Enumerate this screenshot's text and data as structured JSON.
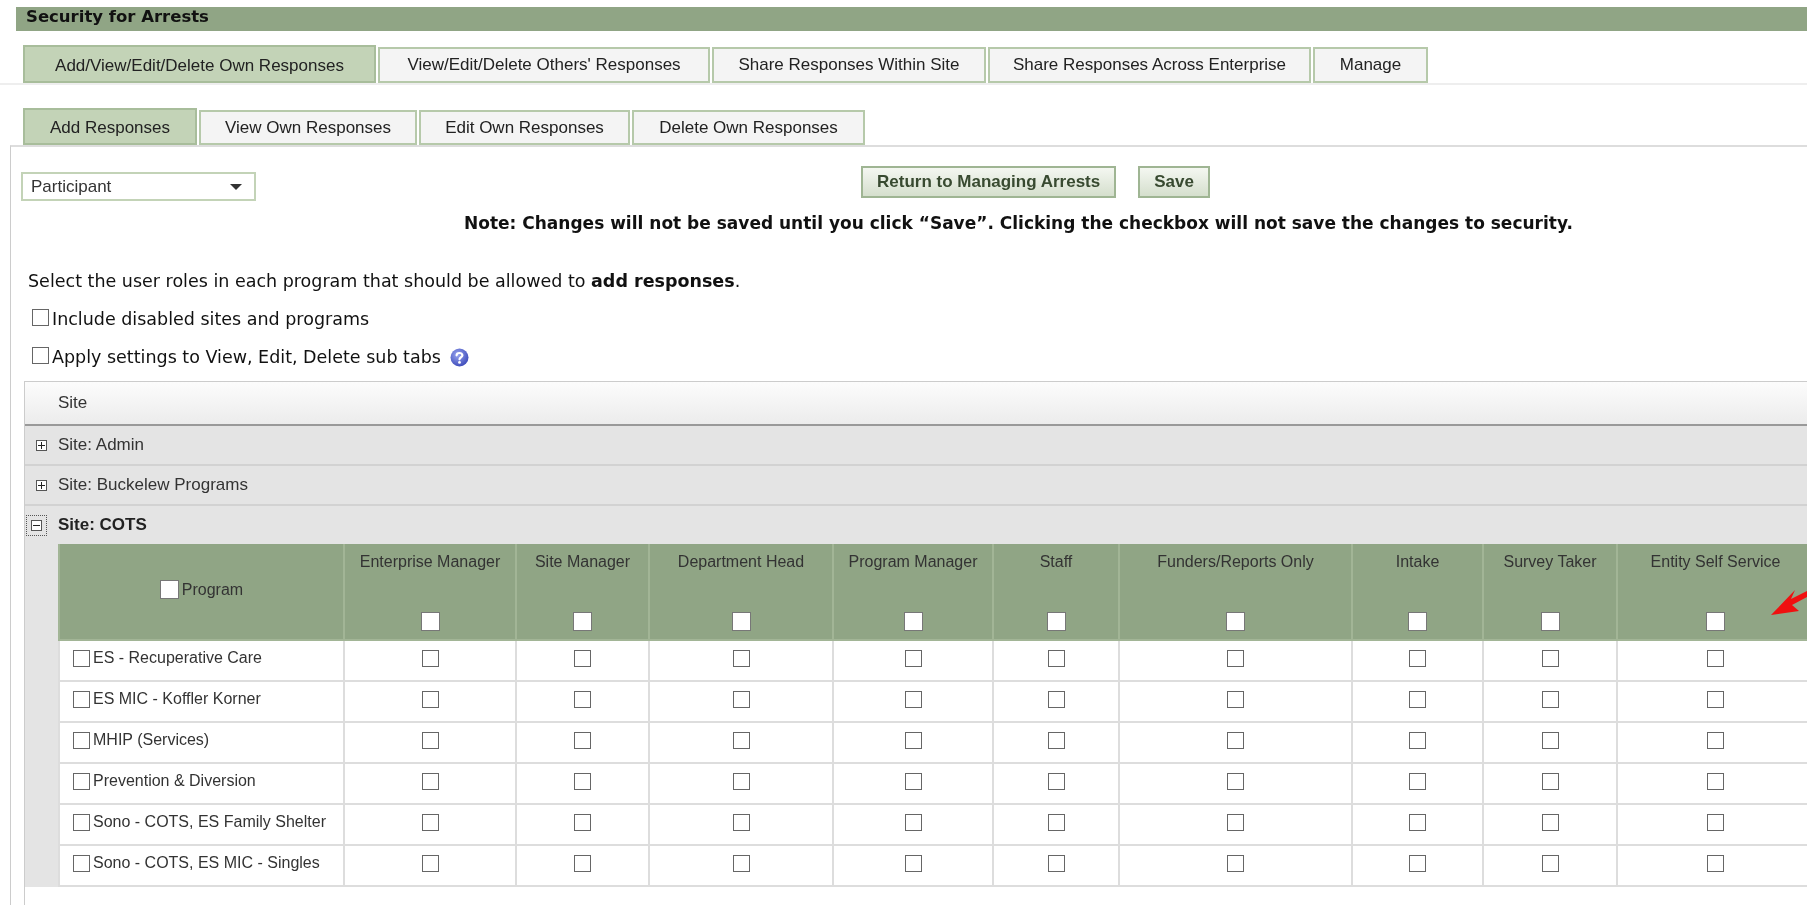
{
  "page_title": "Security for Arrests",
  "main_tabs": [
    {
      "label": "Add/View/Edit/Delete Own Responses",
      "selected": true
    },
    {
      "label": "View/Edit/Delete Others' Responses",
      "selected": false
    },
    {
      "label": "Share Responses Within Site",
      "selected": false
    },
    {
      "label": "Share Responses Across Enterprise",
      "selected": false
    },
    {
      "label": "Manage",
      "selected": false
    }
  ],
  "sub_tabs": [
    {
      "label": "Add Responses",
      "selected": true
    },
    {
      "label": "View Own Responses",
      "selected": false
    },
    {
      "label": "Edit Own Responses",
      "selected": false
    },
    {
      "label": "Delete Own Responses",
      "selected": false
    }
  ],
  "role_select": {
    "value": "Participant"
  },
  "buttons": [
    "Return to Managing Arrests",
    "Save"
  ],
  "note": "Note: Changes will not be saved until you click “Save”. Clicking the checkbox will not save the changes to security.",
  "instruction": "Select the user roles in each program that should be allowed to **add responses**.",
  "options": [
    {
      "label": "Include disabled sites and programs",
      "checked": false,
      "help": false
    },
    {
      "label": "Apply settings to View, Edit, Delete sub tabs",
      "checked": false,
      "help": true
    }
  ],
  "grid": {
    "column": "Site",
    "sites": [
      {
        "name": "Site: Admin",
        "expanded": false
      },
      {
        "name": "Site: Buckelew Programs",
        "expanded": false
      },
      {
        "name": "Site: COTS",
        "expanded": true,
        "program_header": {
          "label": "Program",
          "checked": false
        },
        "roles": [
          {
            "label": "Enterprise Manager",
            "checked": false
          },
          {
            "label": "Site Manager",
            "checked": false
          },
          {
            "label": "Department Head",
            "checked": false
          },
          {
            "label": "Program Manager",
            "checked": false
          },
          {
            "label": "Staff",
            "checked": false
          },
          {
            "label": "Funders/Reports Only",
            "checked": false
          },
          {
            "label": "Intake",
            "checked": false
          },
          {
            "label": "Survey Taker",
            "checked": false
          },
          {
            "label": "Entity Self Service",
            "checked": false
          }
        ],
        "rows": [
          {
            "name": "ES - Recuperative Care",
            "checked": false,
            "roles": [
              false,
              false,
              false,
              false,
              false,
              false,
              false,
              false,
              false
            ]
          },
          {
            "name": "ES MIC - Koffler Korner",
            "checked": false,
            "roles": [
              false,
              false,
              false,
              false,
              false,
              false,
              false,
              false,
              false
            ]
          },
          {
            "name": "MHIP (Services)",
            "checked": false,
            "roles": [
              false,
              false,
              false,
              false,
              false,
              false,
              false,
              false,
              false
            ]
          },
          {
            "name": "Prevention & Diversion",
            "checked": false,
            "roles": [
              false,
              false,
              false,
              false,
              false,
              false,
              false,
              false,
              false
            ]
          },
          {
            "name": "Sono - COTS, ES Family Shelter",
            "checked": false,
            "roles": [
              false,
              false,
              false,
              false,
              false,
              false,
              false,
              false,
              false
            ]
          },
          {
            "name": "Sono - COTS, ES MIC - Singles",
            "checked": false,
            "roles": [
              false,
              false,
              false,
              false,
              false,
              false,
              false,
              false,
              false
            ]
          }
        ]
      }
    ]
  }
}
